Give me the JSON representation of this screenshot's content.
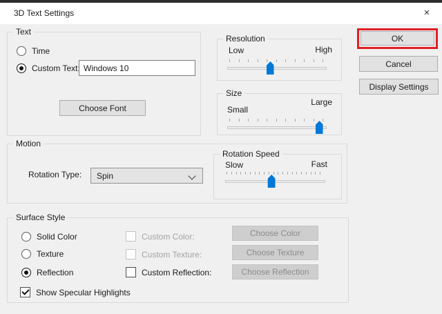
{
  "window": {
    "title": "3D Text Settings"
  },
  "icons": {
    "close": "×"
  },
  "text": {
    "label": "Text",
    "time": {
      "label": "Time",
      "selected": false
    },
    "custom": {
      "label": "Custom Text:",
      "selected": true
    },
    "custom_value": "Windows 10",
    "choose_font": "Choose Font"
  },
  "resolution": {
    "label": "Resolution",
    "min": "Low",
    "max": "High",
    "value_pct": 44,
    "ticks": 11
  },
  "size": {
    "label": "Size",
    "min": "Small",
    "max": "Large",
    "value_pct": 94,
    "ticks": 11
  },
  "motion": {
    "label": "Motion",
    "rotation_type_label": "Rotation Type:",
    "rotation_type_value": "Spin"
  },
  "rotation_speed": {
    "label": "Rotation Speed",
    "min": "Slow",
    "max": "Fast",
    "value_pct": 47,
    "ticks": 21
  },
  "surface_style": {
    "label": "Surface Style",
    "radios": [
      {
        "label": "Solid Color",
        "selected": false
      },
      {
        "label": "Texture",
        "selected": false
      },
      {
        "label": "Reflection",
        "selected": true
      }
    ],
    "checkboxes": [
      {
        "label": "Custom Color:",
        "checked": false,
        "disabled": true
      },
      {
        "label": "Custom Texture:",
        "checked": false,
        "disabled": true
      },
      {
        "label": "Custom Reflection:",
        "checked": false,
        "disabled": false
      }
    ],
    "specular": {
      "label": "Show Specular Highlights",
      "checked": true
    },
    "buttons": [
      {
        "label": "Choose Color",
        "disabled": true
      },
      {
        "label": "Choose Texture",
        "disabled": true
      },
      {
        "label": "Choose Reflection",
        "disabled": true
      }
    ]
  },
  "actions": {
    "ok": "OK",
    "cancel": "Cancel",
    "display_settings": "Display Settings"
  },
  "annotation": {
    "highlight_color": "#e11d25",
    "highlighted_button": "OK"
  },
  "colors": {
    "accent": "#0078d7",
    "dialog_bg": "#f0f0f0",
    "titlebar_bg": "#ffffff"
  }
}
